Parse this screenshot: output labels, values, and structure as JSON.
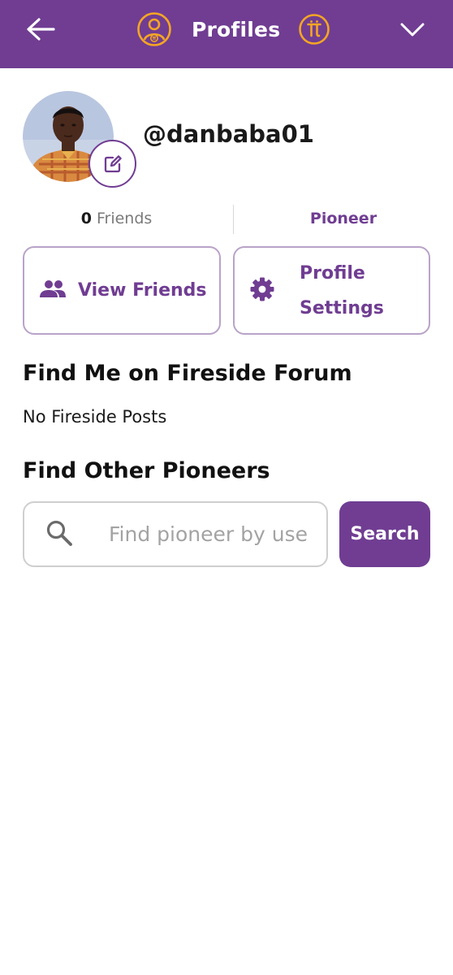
{
  "header": {
    "title": "Profiles",
    "back_icon": "arrow-left-icon",
    "profile_icon": "profile-circle-icon",
    "pi_icon": "pi-coin-icon",
    "menu_icon": "chevron-down-icon",
    "background_color": "#703D92",
    "accent_color": "#F5A623"
  },
  "profile": {
    "username": "@danbaba01",
    "avatar": "avatar-photo",
    "edit_icon": "pencil-edit-icon"
  },
  "stats": {
    "friends_count": "0",
    "friends_label": "Friends",
    "role": "Pioneer"
  },
  "actions": {
    "view_friends_label": "View Friends",
    "view_friends_icon": "people-icon",
    "profile_settings_line1": "Profile",
    "profile_settings_line2": "Settings",
    "profile_settings_icon": "gear-icon"
  },
  "fireside": {
    "title": "Find Me on Fireside Forum",
    "empty_text": "No Fireside Posts"
  },
  "pioneers": {
    "title": "Find Other Pioneers",
    "search_placeholder": "Find pioneer by username",
    "search_value": "",
    "search_button": "Search",
    "search_icon": "search-icon"
  }
}
